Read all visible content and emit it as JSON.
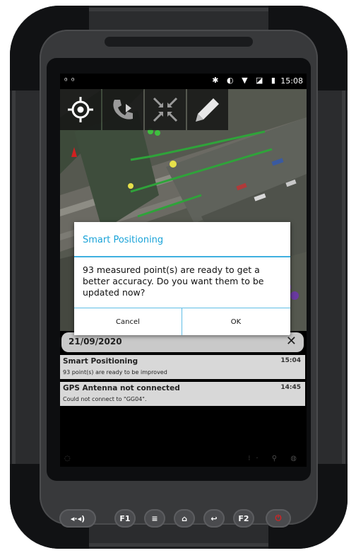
{
  "status_bar": {
    "left_icons": "⁰ ⁰",
    "right_icons": "✱ ◐ ▼ ◪ ▮",
    "time": "15:08"
  },
  "toolbar": {
    "items": [
      {
        "icon": "crosshair-icon"
      },
      {
        "icon": "phone-forward-icon"
      },
      {
        "icon": "collapse-arrows-icon"
      },
      {
        "icon": "pencil-icon"
      }
    ]
  },
  "dialog": {
    "title": "Smart Positioning",
    "message": "93 measured point(s) are ready to get a better accuracy. Do you want them to be updated now?",
    "cancel_label": "Cancel",
    "ok_label": "OK",
    "accent_color": "#1aa3d8"
  },
  "notifications": {
    "date": "21/09/2020",
    "close_glyph": "✕",
    "items": [
      {
        "title": "Smart Positioning",
        "time": "15:04",
        "body": "93 point(s) are ready to be improved"
      },
      {
        "title": "GPS Antenna not connected",
        "time": "14:45",
        "body": "Could not connect to \"GG04\"."
      }
    ]
  },
  "navbar": {
    "left_icon": "◌",
    "right_icons": "⁝· ⚲ ◍"
  },
  "hardware_buttons": {
    "volume": "◂·◂)",
    "f1": "F1",
    "menu": "≡",
    "home": "⌂",
    "back": "↩",
    "f2": "F2",
    "power": "⏻"
  }
}
